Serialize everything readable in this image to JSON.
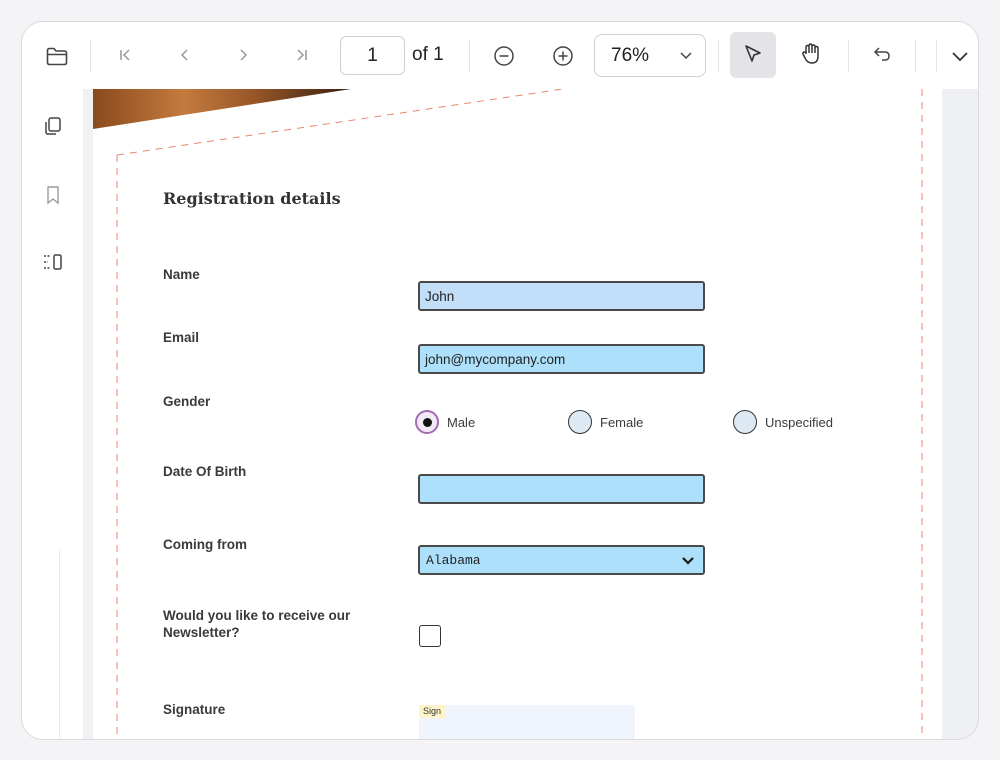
{
  "toolbar": {
    "current_page": "1",
    "page_of": "of 1",
    "zoom": "76%",
    "icons": [
      "folder-icon",
      "first-page-icon",
      "prev-page-icon",
      "next-page-icon",
      "last-page-icon",
      "zoom-out-icon",
      "zoom-in-icon",
      "select-cursor-icon",
      "pan-hand-icon",
      "undo-icon",
      "more-chevron-icon"
    ]
  },
  "sidebar": {
    "icons": [
      "thumbnails-icon",
      "bookmark-icon",
      "form-fields-icon"
    ]
  },
  "form": {
    "heading": "Registration details",
    "name_label": "Name",
    "name_value": "John",
    "email_label": "Email",
    "email_value": "john@mycompany.com",
    "gender_label": "Gender",
    "gender_options": [
      "Male",
      "Female",
      "Unspecified"
    ],
    "gender_selected": "Male",
    "dob_label": "Date Of Birth",
    "dob_value": "",
    "coming_from_label": "Coming from",
    "coming_from_value": "Alabama",
    "newsletter_label": "Would you like to receive our Newsletter?",
    "newsletter_checked": false,
    "signature_label": "Signature",
    "signature_tag": "Sign"
  },
  "colors": {
    "field_fill": "#ade1fb",
    "active_field_fill": "#c3def8",
    "page_border_dash": "#e8876c",
    "radio_selected_ring": "#a56ab5"
  }
}
